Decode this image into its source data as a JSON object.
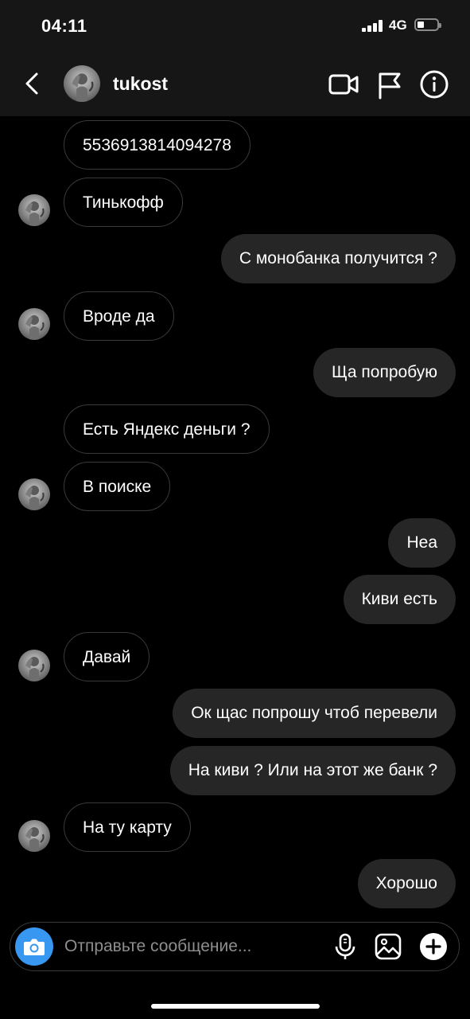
{
  "status": {
    "time": "04:11",
    "network": "4G"
  },
  "header": {
    "username": "tukost"
  },
  "messages": [
    {
      "text": "5536913814094278",
      "side": "in"
    },
    {
      "text": "Тинькофф",
      "side": "in"
    },
    {
      "text": "С монобанка получится ?",
      "side": "out"
    },
    {
      "text": "Вроде да",
      "side": "in"
    },
    {
      "text": "Ща попробую",
      "side": "out"
    },
    {
      "text": "Есть Яндекс деньги ?",
      "side": "in"
    },
    {
      "text": "В поиске",
      "side": "in"
    },
    {
      "text": "Неа",
      "side": "out"
    },
    {
      "text": "Киви есть",
      "side": "out"
    },
    {
      "text": "Давай",
      "side": "in"
    },
    {
      "text": "Ок щас попрошу чтоб перевели",
      "side": "out"
    },
    {
      "text": "На киви ? Или на этот же банк ?",
      "side": "out"
    },
    {
      "text": "На ту карту",
      "side": "in"
    },
    {
      "text": "Хорошо",
      "side": "out"
    }
  ],
  "composer": {
    "placeholder": "Отправьте сообщение..."
  },
  "colors": {
    "header_bg": "#161616",
    "outgoing_bubble": "#262626",
    "camera_button": "#3897f0"
  }
}
